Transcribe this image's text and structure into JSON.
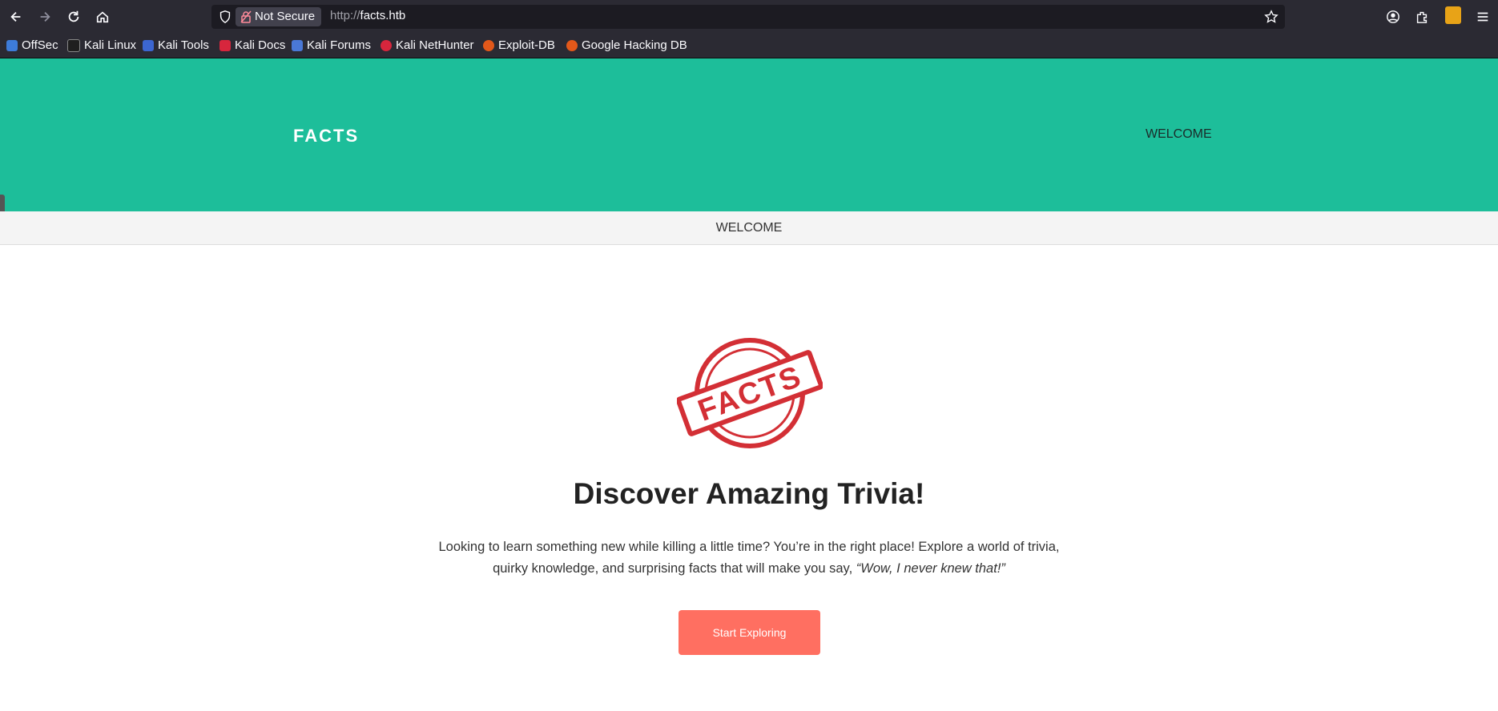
{
  "browser": {
    "security_label": "Not Secure",
    "url_protocol": "http://",
    "url_host": "facts.htb",
    "bookmarks": [
      {
        "label": "OffSec",
        "color": "#3d7bd9"
      },
      {
        "label": "Kali Linux",
        "color": "#1f1f1f"
      },
      {
        "label": "Kali Tools",
        "color": "#3c66d1"
      },
      {
        "label": "Kali Docs",
        "color": "#d7263d"
      },
      {
        "label": "Kali Forums",
        "color": "#4a78d6"
      },
      {
        "label": "Kali NetHunter",
        "color": "#d7263d"
      },
      {
        "label": "Exploit-DB",
        "color": "#e2581a"
      },
      {
        "label": "Google Hacking DB",
        "color": "#e2581a"
      }
    ]
  },
  "header": {
    "brand": "FACTS",
    "nav_item": "WELCOME",
    "background": "#1dbe9a"
  },
  "subnav": {
    "item": "WELCOME"
  },
  "hero": {
    "logo_text": "FACTS",
    "title": "Discover Amazing Trivia!",
    "text_main": "Looking to learn something new while killing a little time? You’re in the right place! Explore a world of trivia, quirky knowledge, and surprising facts that will make you say,",
    "text_quote": "“Wow, I never knew that!”",
    "button_label": "Start Exploring",
    "button_color": "#ff6f61"
  }
}
